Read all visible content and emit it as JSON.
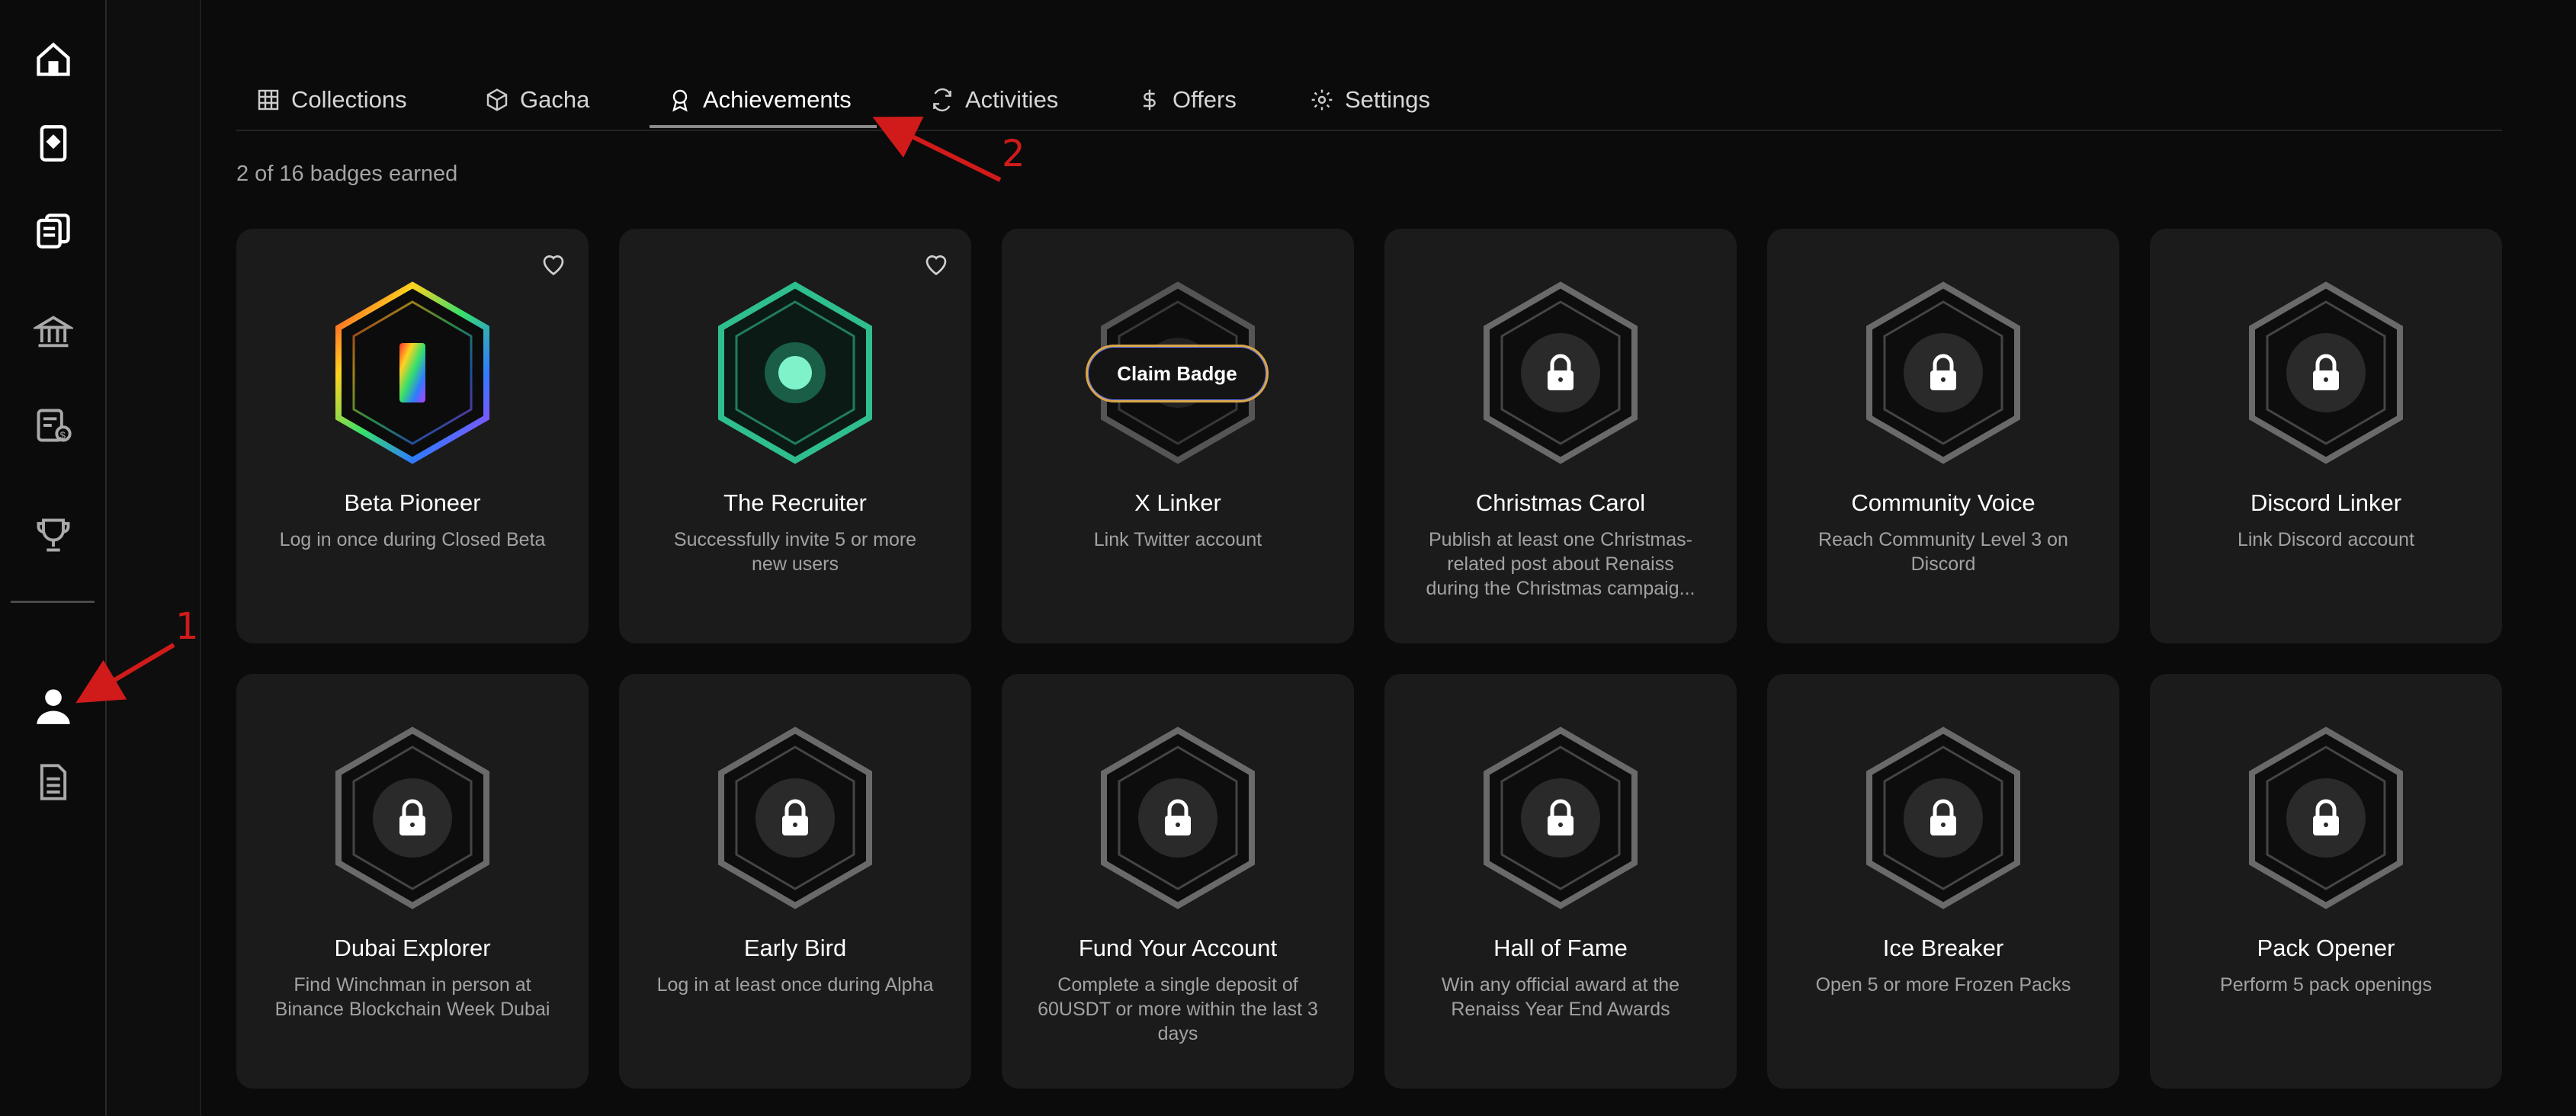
{
  "sidebar": {
    "icons": [
      "home-icon",
      "cards-icon",
      "collection-stack-icon",
      "bank-icon",
      "card-dollar-icon",
      "trophy-icon",
      "profile-icon",
      "document-icon"
    ]
  },
  "tabs": [
    {
      "label": "Collections",
      "icon": "grid-icon"
    },
    {
      "label": "Gacha",
      "icon": "gacha-cube-icon"
    },
    {
      "label": "Achievements",
      "icon": "award-icon",
      "active": true
    },
    {
      "label": "Activities",
      "icon": "refresh-icon"
    },
    {
      "label": "Offers",
      "icon": "dollar-icon"
    },
    {
      "label": "Settings",
      "icon": "gear-icon"
    }
  ],
  "summary": "2 of 16 badges earned",
  "claim_label": "Claim Badge",
  "annotations": {
    "one": "1",
    "two": "2"
  },
  "badges": [
    {
      "title": "Beta Pioneer",
      "desc": [
        "Log in once during Closed Beta"
      ],
      "state": "earned",
      "color": "rainbow"
    },
    {
      "title": "The Recruiter",
      "desc": [
        "Successfully invite 5 or more",
        "new users"
      ],
      "state": "earned",
      "color": "#2fbf8f"
    },
    {
      "title": "X Linker",
      "desc": [
        "Link Twitter account"
      ],
      "state": "claimable"
    },
    {
      "title": "Christmas Carol",
      "desc": [
        "Publish at least one Christmas-",
        "related post about Renaiss",
        "during the Christmas campaig..."
      ],
      "state": "locked"
    },
    {
      "title": "Community Voice",
      "desc": [
        "Reach Community Level 3 on",
        "Discord"
      ],
      "state": "locked"
    },
    {
      "title": "Discord Linker",
      "desc": [
        "Link Discord account"
      ],
      "state": "locked"
    },
    {
      "title": "Dubai Explorer",
      "desc": [
        "Find Winchman in person at",
        "Binance Blockchain Week Dubai"
      ],
      "state": "locked"
    },
    {
      "title": "Early Bird",
      "desc": [
        "Log in at least once during Alpha"
      ],
      "state": "locked"
    },
    {
      "title": "Fund Your Account",
      "desc": [
        "Complete a single deposit of",
        "60USDT or more within the last 3",
        "days"
      ],
      "state": "locked"
    },
    {
      "title": "Hall of Fame",
      "desc": [
        "Win any official award at the",
        "Renaiss Year End Awards"
      ],
      "state": "locked"
    },
    {
      "title": "Ice Breaker",
      "desc": [
        "Open 5 or more Frozen Packs"
      ],
      "state": "locked"
    },
    {
      "title": "Pack Opener",
      "desc": [
        "Perform 5 pack openings"
      ],
      "state": "locked"
    }
  ],
  "colors": {
    "accent_red": "#d11a1a",
    "card_bg": "#1b1b1b",
    "claim_border": "#d9a74a"
  }
}
